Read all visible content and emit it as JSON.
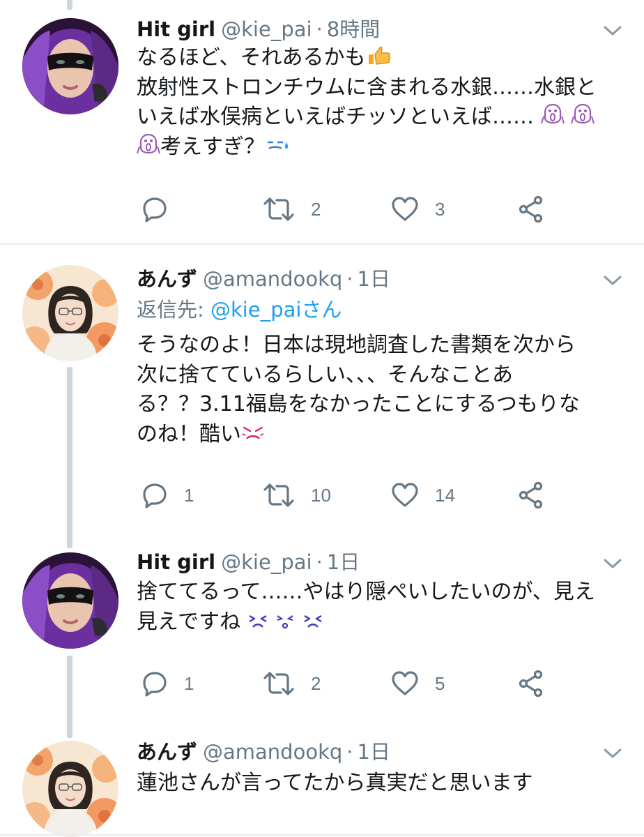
{
  "tweets": [
    {
      "display_name": "Hit girl",
      "handle": "@kie_pai",
      "separator": "·",
      "time": "8時間",
      "avatar": "hit-girl-avatar",
      "text_lines": [
        "なるほど、それあるかも",
        "放射性ストロンチウムに含まれる水銀……水銀と",
        "いえば水俣病といえばチッソといえば……",
        "考えすぎ？"
      ],
      "emojis": [
        "thumbs-up",
        "screaming-face",
        "screaming-face",
        "screaming-face",
        "sweat-face"
      ],
      "replies": "",
      "retweets": "2",
      "likes": "3"
    },
    {
      "display_name": "あんず",
      "handle": "@amandookq",
      "separator": "·",
      "time": "1日",
      "avatar": "anzu-avatar",
      "reply_to_label": "返信先: ",
      "reply_to_handle": "@kie_paiさん",
      "text_lines": [
        "そうなのよ！日本は現地調査した書類を次から",
        "次に捨てているらしい、、、そんなことあ",
        "る？？3.11福島をなかったことにするつもりな",
        "のね！酷い"
      ],
      "emojis": [
        "angry-face"
      ],
      "replies": "1",
      "retweets": "10",
      "likes": "14"
    },
    {
      "display_name": "Hit girl",
      "handle": "@kie_pai",
      "separator": "·",
      "time": "1日",
      "avatar": "hit-girl-avatar",
      "text_lines": [
        "捨ててるって……やはり隠ぺいしたいのが、見え",
        "見えですね"
      ],
      "emojis": [
        "frustrated-face",
        "surprised-face",
        "frustrated-face"
      ],
      "replies": "1",
      "retweets": "2",
      "likes": "5"
    },
    {
      "display_name": "あんず",
      "handle": "@amandookq",
      "separator": "·",
      "time": "1日",
      "avatar": "anzu-avatar",
      "text_lines": [
        "蓮池さんが言ってたから真実だと思います"
      ]
    }
  ],
  "colors": {
    "text": "#14171a",
    "secondary": "#657786",
    "link": "#1da1f2",
    "thread_line": "#ccd6dd",
    "divider": "#e6ecf0"
  },
  "icons": [
    "reply-icon",
    "retweet-icon",
    "like-icon",
    "share-icon",
    "chevron-down-icon"
  ]
}
